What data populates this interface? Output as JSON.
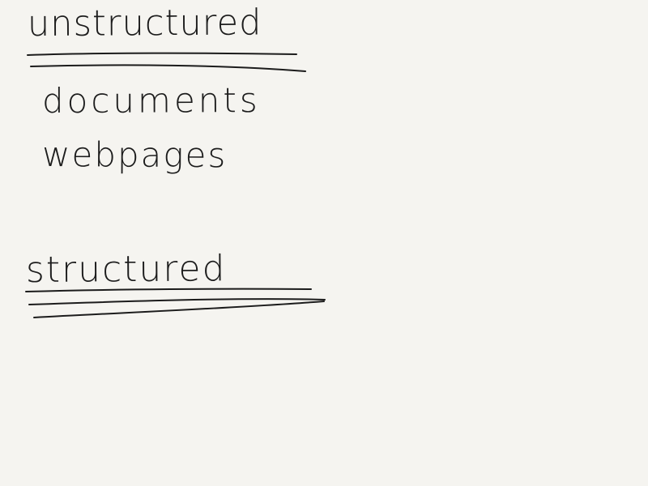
{
  "note": {
    "headings": {
      "unstructured": "unstructured",
      "structured": "structured"
    },
    "unstructured_items": [
      "documents",
      "webpages"
    ]
  },
  "colors": {
    "paper": "#f5f4f0",
    "ink": "#1c1c1c"
  }
}
